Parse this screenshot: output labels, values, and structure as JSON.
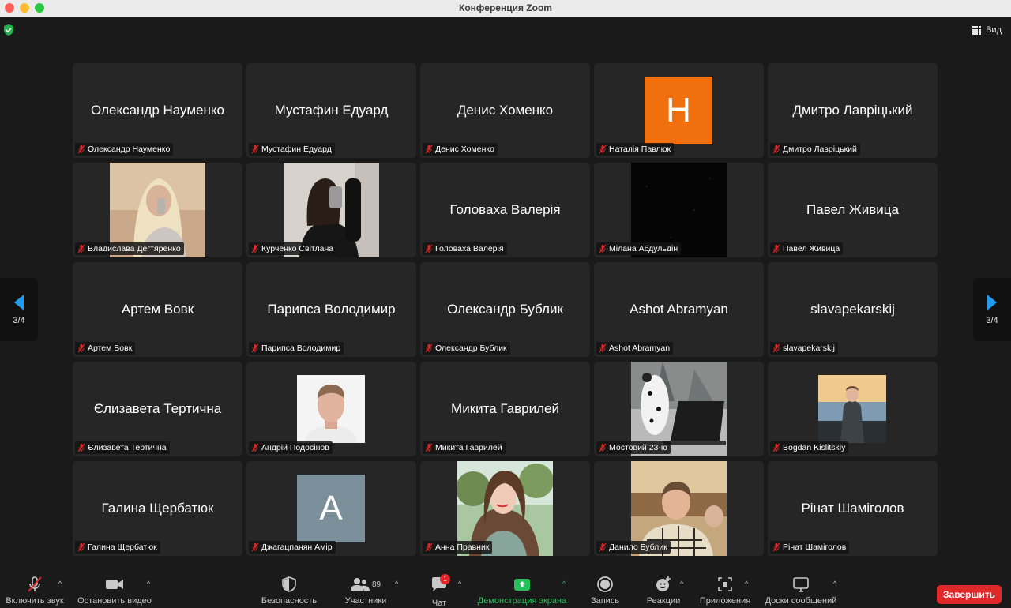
{
  "window": {
    "title": "Конференция Zoom"
  },
  "header": {
    "view_label": "Вид"
  },
  "pager": {
    "left": "3/4",
    "right": "3/4"
  },
  "tiles": [
    {
      "name": "Олександр Науменко",
      "display": "Олександр Науменко",
      "kind": "name"
    },
    {
      "name": "Мустафин Едуард",
      "display": "Мустафин Едуард",
      "kind": "name"
    },
    {
      "name": "Денис Хоменко",
      "display": "Денис Хоменко",
      "kind": "name"
    },
    {
      "name": "Наталія Павлюк",
      "letter": "Н",
      "kind": "letter",
      "color": "#f06f0f"
    },
    {
      "name": "Дмитро Лаврiцький",
      "display": "Дмитро Лаврiцький",
      "kind": "name"
    },
    {
      "name": "Владислава Дегтяренко",
      "kind": "photo",
      "photo": "blonde-selfie"
    },
    {
      "name": "Курченко Світлана",
      "kind": "photo",
      "photo": "mirror-selfie"
    },
    {
      "name": "Головаха Валерія",
      "display": "Головаха Валерія",
      "kind": "name"
    },
    {
      "name": "Мiлана Абдульдiн",
      "kind": "photo",
      "photo": "black-sky"
    },
    {
      "name": "Павел Живица",
      "display": "Павел Живица",
      "kind": "name"
    },
    {
      "name": "Артем Вовк",
      "display": "Артем Вовк",
      "kind": "name"
    },
    {
      "name": "Парипса Володимир",
      "display": "Парипса Володимир",
      "kind": "name"
    },
    {
      "name": "Олександр Бублик",
      "display": "Олександр Бублик",
      "kind": "name"
    },
    {
      "name": "Ashot Abramyan",
      "display": "Ashot Abramyan",
      "kind": "name"
    },
    {
      "name": "slavapekarskij",
      "display": "slavapekarskij",
      "kind": "name"
    },
    {
      "name": "Єлизавета Тертична",
      "display": "Єлизавета Тертична",
      "kind": "name"
    },
    {
      "name": "Андрій Подосінов",
      "kind": "photo-sq",
      "photo": "passport-photo"
    },
    {
      "name": "Микита Гаврилей",
      "display": "Микита Гаврилей",
      "kind": "name"
    },
    {
      "name": "Мостовий 23-ю",
      "kind": "photo",
      "photo": "dalmatian-laptop"
    },
    {
      "name": "Bogdan Kislitskiy",
      "kind": "photo-sq",
      "photo": "suit-sunset"
    },
    {
      "name": "Галина Щербатюк",
      "display": "Галина Щербатюк",
      "kind": "name"
    },
    {
      "name": "Джагацпанян Амiр",
      "letter": "A",
      "kind": "letter",
      "color": "#7b8f9a"
    },
    {
      "name": "Анна Правник",
      "kind": "photo",
      "photo": "girl-outdoor"
    },
    {
      "name": "Данило Бублик",
      "kind": "photo",
      "photo": "man-checked-shirt"
    },
    {
      "name": "Рінат Шамiголов",
      "display": "Рінат Шамiголов",
      "kind": "name"
    }
  ],
  "toolbar": {
    "unmute": "Включить звук",
    "stop_video": "Остановить видео",
    "security": "Безопасность",
    "participants": "Участники",
    "participants_count": "89",
    "chat": "Чат",
    "chat_badge": "1",
    "share": "Демонстрация экрана",
    "record": "Запись",
    "reactions": "Реакции",
    "apps": "Приложения",
    "whiteboards": "Доски сообщений",
    "end": "Завершить"
  },
  "colors": {
    "share_green": "#25c05a",
    "end_red": "#e02828",
    "nav_arrow": "#1f9bf0"
  }
}
